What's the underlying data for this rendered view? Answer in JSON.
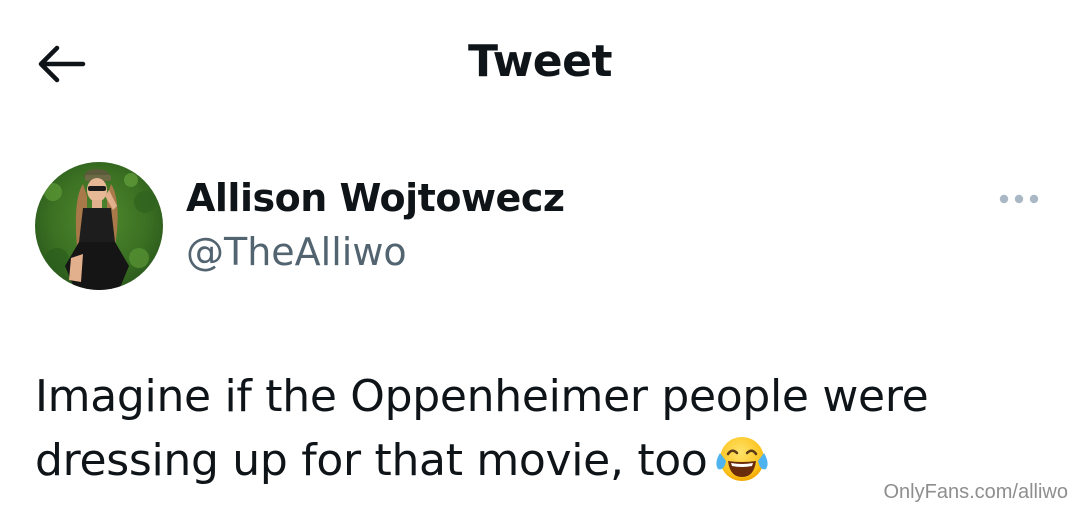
{
  "header": {
    "title": "Tweet",
    "back_icon": "arrow-left-icon"
  },
  "author": {
    "display_name": "Allison Wojtowecz",
    "handle": "@TheAlliwo",
    "avatar_icon": "profile-photo"
  },
  "more_icon": "more-horizontal-icon",
  "tweet": {
    "text": "Imagine if the Oppenheimer people were dressing up for that movie, too",
    "emoji": "face-with-tears-of-joy"
  },
  "watermark": {
    "text": "OnlyFans.com/alliwo"
  },
  "colors": {
    "text_primary": "#0f1419",
    "text_secondary": "#536471",
    "more_dots": "#a9b8c4",
    "background": "#ffffff"
  }
}
